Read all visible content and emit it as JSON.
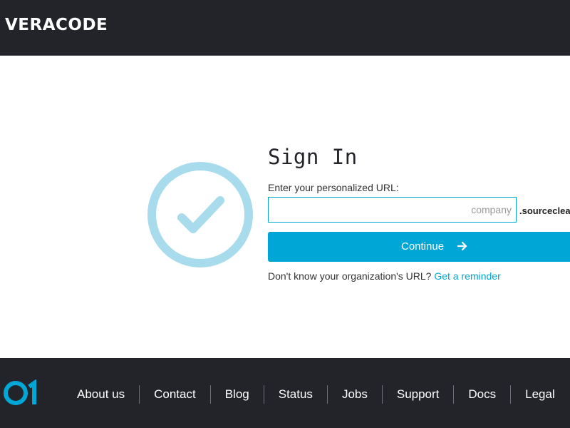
{
  "header": {
    "logo_text": "VERACODE"
  },
  "icons": {
    "success": "check-circle-icon",
    "continue": "arrow-right-icon",
    "footer_logo": "veracode-01-icon"
  },
  "colors": {
    "accent": "#00a7d6",
    "dark_bg": "#222429",
    "check_circle": "#a8dcec"
  },
  "signin": {
    "title": "Sign In",
    "url_label": "Enter your personalized URL:",
    "url_placeholder": "company",
    "url_value": "",
    "url_suffix": ".sourceclear",
    "continue_label": "Continue",
    "reminder_text": "Don't know your organization's URL?",
    "reminder_link": "Get a reminder"
  },
  "footer": {
    "links": [
      "About us",
      "Contact",
      "Blog",
      "Status",
      "Jobs",
      "Support",
      "Docs",
      "Legal"
    ]
  }
}
